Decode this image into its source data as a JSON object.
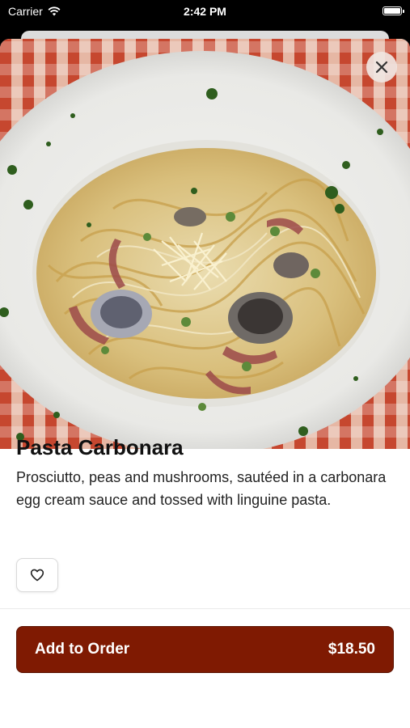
{
  "status_bar": {
    "carrier": "Carrier",
    "time": "2:42 PM"
  },
  "item": {
    "name": "Pasta Carbonara",
    "description": "Prosciutto, peas and mushrooms, sautéed in a carbonara egg cream sauce and tossed with linguine pasta."
  },
  "order_button": {
    "label": "Add to Order",
    "price": "$18.50"
  },
  "icons": {
    "close": "close-icon",
    "favorite": "heart-outline-icon",
    "wifi": "wifi-icon",
    "battery": "battery-icon"
  },
  "colors": {
    "accent": "#7f1a02"
  }
}
